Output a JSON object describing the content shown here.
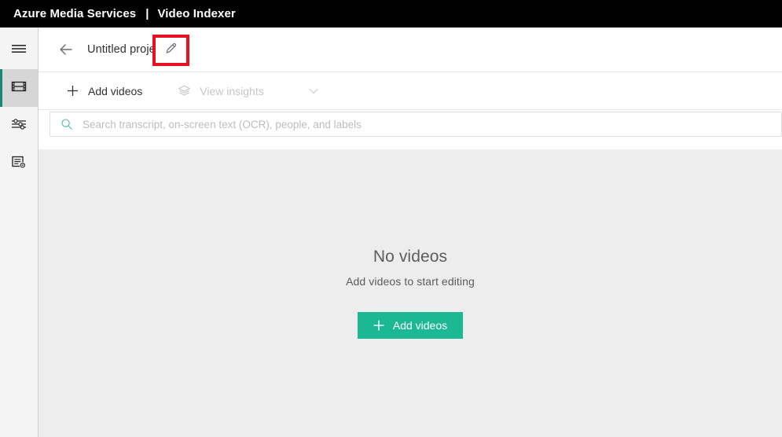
{
  "topbar": {
    "brand": "Azure Media Services",
    "separator": "|",
    "product": "Video Indexer"
  },
  "sidebar": {
    "items": [
      {
        "icon": "hamburger-menu-icon",
        "name": "menu",
        "selected": false
      },
      {
        "icon": "film-strip-icon",
        "name": "media",
        "selected": true
      },
      {
        "icon": "sliders-icon",
        "name": "customization",
        "selected": false
      },
      {
        "icon": "document-settings-icon",
        "name": "account-settings",
        "selected": false
      }
    ],
    "accent_color": "#128a72",
    "selected_background": "#d6d6d6"
  },
  "title_row": {
    "back_icon": "arrow-left-icon",
    "project_name": "Untitled project",
    "edit_icon": "pencil-edit-icon",
    "highlight_color": "#e81123"
  },
  "command_bar": {
    "add_videos": {
      "label": "Add videos",
      "icon": "plus-icon",
      "disabled": false
    },
    "view_insights": {
      "label": "View insights",
      "icon": "layers-stack-icon",
      "disabled": true
    },
    "chevron": "chevron-down-icon"
  },
  "search": {
    "placeholder": "Search transcript, on-screen text (OCR), people, and labels",
    "value": "",
    "icon": "search-icon",
    "icon_color": "#4fb99f"
  },
  "empty_state": {
    "title": "No videos",
    "subtitle": "Add videos to start editing",
    "button_label": "Add videos",
    "button_icon": "plus-icon",
    "button_color": "#1cb894",
    "background_color": "#ededed"
  }
}
